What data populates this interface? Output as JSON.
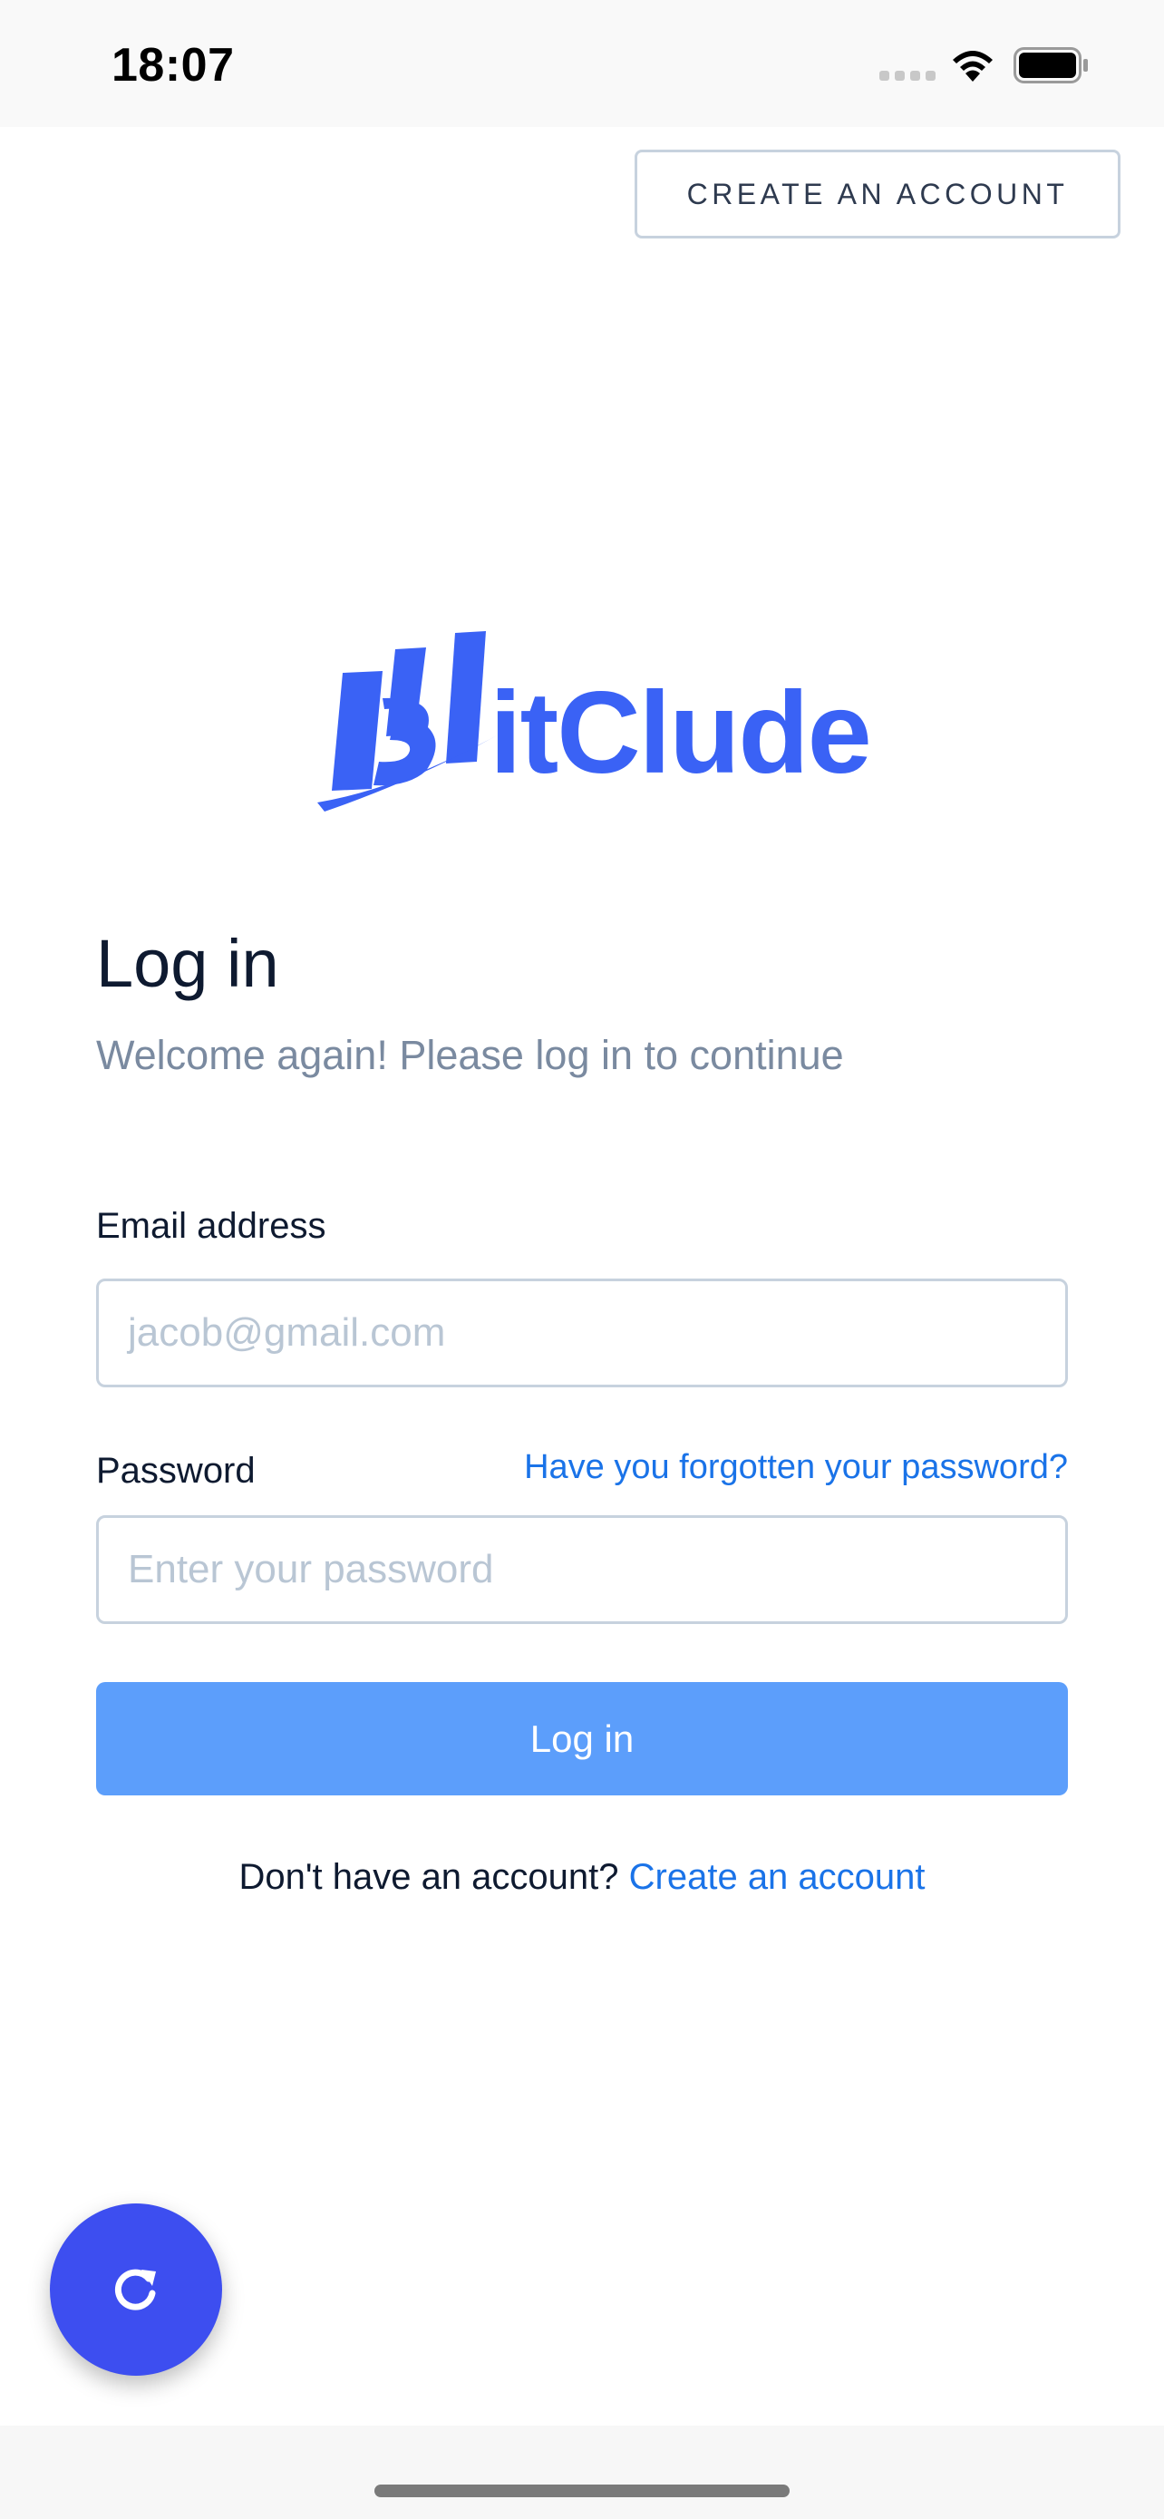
{
  "status_bar": {
    "time": "18:07"
  },
  "header": {
    "create_account_label": "CREATE AN ACCOUNT"
  },
  "logo": {
    "brand_name": "BitClude",
    "brand_color": "#3a62f5"
  },
  "login": {
    "title": "Log in",
    "subtitle": "Welcome again! Please log in to continue",
    "email_label": "Email address",
    "email_placeholder": "jacob@gmail.com",
    "password_label": "Password",
    "forgot_password": "Have you forgotten your password?",
    "password_placeholder": "Enter your password",
    "submit_label": "Log in",
    "no_account_text": "Don't have an account?",
    "create_account_link": "Create an account"
  },
  "fab": {
    "icon": "refresh-icon"
  },
  "colors": {
    "accent": "#5c9efb",
    "link": "#1a73e8",
    "fab": "#3d4ef0"
  }
}
